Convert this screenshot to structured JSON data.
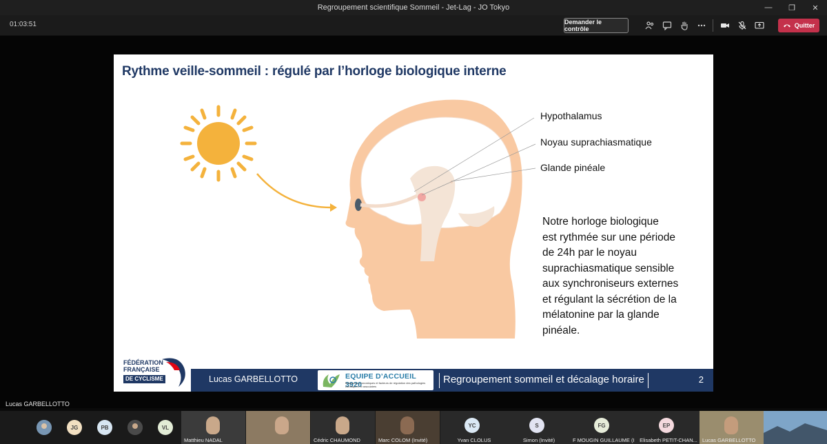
{
  "window": {
    "title": "Regroupement scientifique Sommeil - Jet-Lag - JO Tokyo"
  },
  "toolbar": {
    "timer": "01:03:51",
    "request_control": "Demander le contrôle",
    "quit": "Quitter"
  },
  "slide": {
    "title": "Rythme veille-sommeil : régulé par l’horloge biologique interne",
    "labels": {
      "hypothalamus": "Hypothalamus",
      "scn": "Noyau suprachiasmatique",
      "pineal": "Glande pinéale"
    },
    "body_lines": [
      "Notre horloge biologique",
      "est rythmée sur une période",
      "de 24h par le noyau",
      "suprachiasmatique sensible",
      "aux synchroniseurs externes",
      "et régulant la sécrétion de la",
      "mélatonine par la glande",
      "pinéale."
    ],
    "footer": {
      "logo_lines": [
        "FÉDÉRATION",
        "FRANÇAISE",
        "DE CYCLISME"
      ],
      "presenter": "Lucas GARBELLOTTO",
      "ea_title": "EQUIPE D’ACCUEIL 3920",
      "ea_subtitle": "Marqueurs pronostiques et facteurs de régulation des pathologies cardiaques et vasculaires",
      "title": "Regroupement sommeil et décalage horaire",
      "page": "2"
    }
  },
  "presenter_label": "Lucas GARBELLOTTO",
  "participants": {
    "initials": [
      "JG",
      "PB",
      "VL"
    ],
    "videos": [
      "Matthieu NADAL",
      "Cédric CHAUMOND",
      "Marc COLOM (Invité)",
      "Lucas GARBELLOTTO"
    ],
    "tiles": [
      {
        "initials": "YC",
        "name": "Yvan CLOLUS",
        "color": "#dbe9f5"
      },
      {
        "initials": "S",
        "name": "Simon (Invité)",
        "color": "#e2e4f2"
      },
      {
        "initials": "FG",
        "name": "F MOUGIN GUILLAUME (I...",
        "color": "#e6ecd9"
      },
      {
        "initials": "EP",
        "name": "Elisabeth PETIT-CHAN...",
        "color": "#f4d9de"
      }
    ]
  }
}
